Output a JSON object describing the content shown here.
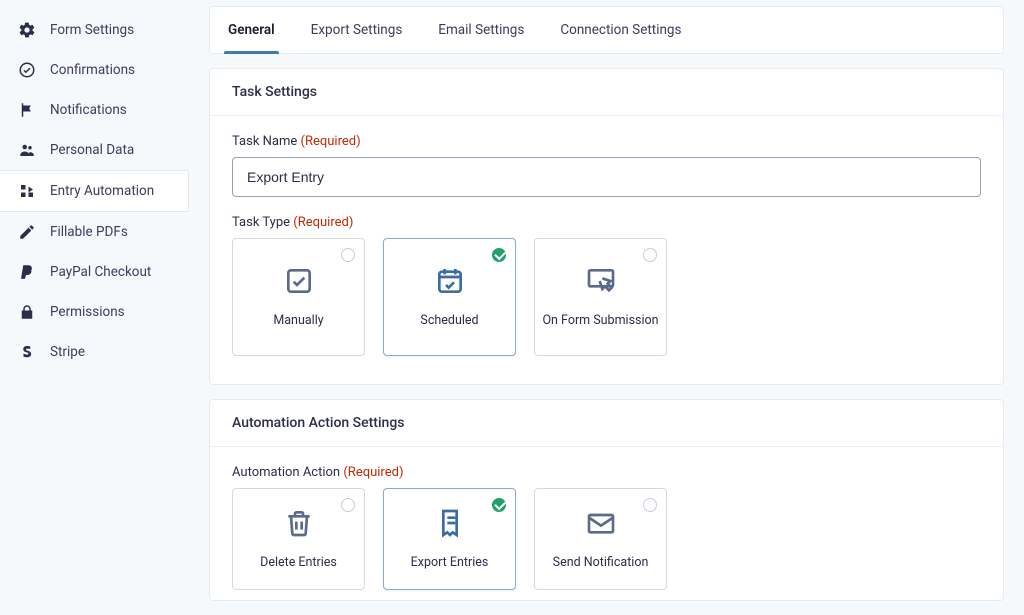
{
  "sidebar": {
    "items": [
      {
        "label": "Form Settings",
        "icon": "gear"
      },
      {
        "label": "Confirmations",
        "icon": "check-circle"
      },
      {
        "label": "Notifications",
        "icon": "flag"
      },
      {
        "label": "Personal Data",
        "icon": "people"
      },
      {
        "label": "Entry Automation",
        "icon": "automation",
        "active": true
      },
      {
        "label": "Fillable PDFs",
        "icon": "pen"
      },
      {
        "label": "PayPal Checkout",
        "icon": "paypal"
      },
      {
        "label": "Permissions",
        "icon": "lock"
      },
      {
        "label": "Stripe",
        "icon": "stripe"
      }
    ]
  },
  "tabs": {
    "items": [
      {
        "label": "General",
        "active": true
      },
      {
        "label": "Export Settings"
      },
      {
        "label": "Email Settings"
      },
      {
        "label": "Connection Settings"
      }
    ]
  },
  "task_settings": {
    "heading": "Task Settings",
    "name_label": "Task Name",
    "required_text": "(Required)",
    "name_value": "Export Entry",
    "type_label": "Task Type",
    "options": [
      {
        "label": "Manually",
        "selected": false
      },
      {
        "label": "Scheduled",
        "selected": true
      },
      {
        "label": "On Form Submission",
        "selected": false
      }
    ]
  },
  "automation_settings": {
    "heading": "Automation Action Settings",
    "action_label": "Automation Action",
    "required_text": "(Required)",
    "options": [
      {
        "label": "Delete Entries",
        "selected": false
      },
      {
        "label": "Export Entries",
        "selected": true
      },
      {
        "label": "Send Notification",
        "selected": false
      }
    ]
  }
}
